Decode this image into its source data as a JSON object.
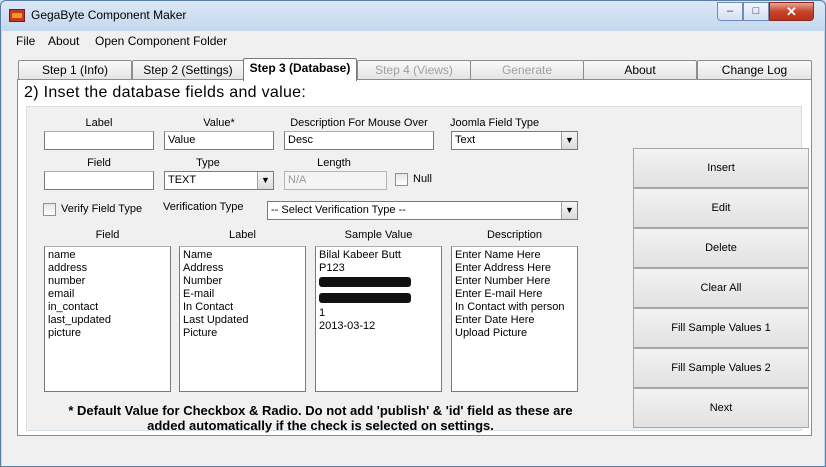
{
  "window": {
    "title": "GegaByte Component Maker",
    "min_glyph": "–",
    "max_glyph": "□",
    "close_glyph": "✕"
  },
  "menu": [
    "File",
    "About",
    "Open Component Folder"
  ],
  "tabs": [
    {
      "label": "Step 1 (Info)",
      "state": "normal"
    },
    {
      "label": "Step 2 (Settings)",
      "state": "normal"
    },
    {
      "label": "Step 3 (Database)",
      "state": "active"
    },
    {
      "label": "Step 4 (Views)",
      "state": "disabled"
    },
    {
      "label": "Generate",
      "state": "disabled"
    },
    {
      "label": "About",
      "state": "normal"
    },
    {
      "label": "Change Log",
      "state": "normal"
    }
  ],
  "heading": "2) Inset the database fields and value:",
  "form": {
    "label_lbl": "Label",
    "label_value": "",
    "value_lbl": "Value*",
    "value_value": "Value",
    "desc_lbl": "Description For Mouse Over",
    "desc_value": "Desc",
    "joomla_lbl": "Joomla Field Type",
    "joomla_value": "Text",
    "field_lbl": "Field",
    "field_value": "",
    "type_lbl": "Type",
    "type_value": "TEXT",
    "length_lbl": "Length",
    "length_value": "N/A",
    "null_lbl": "Null",
    "verify_lbl": "Verify Field Type",
    "vtype_lbl": "Verification Type",
    "vtype_value": "-- Select Verification Type --"
  },
  "lists": {
    "field_header": "Field",
    "label_header": "Label",
    "sample_header": "Sample Value",
    "desc_header": "Description",
    "fields": [
      "name",
      "address",
      "number",
      "email",
      "in_contact",
      "last_updated",
      "picture"
    ],
    "labels": [
      "Name",
      "Address",
      "Number",
      "E-mail",
      "In Contact",
      "Last Updated",
      "Picture"
    ],
    "samples": [
      "Bilal Kabeer Butt",
      "P123",
      "",
      "",
      "1",
      "2013-03-12"
    ],
    "descriptions": [
      "Enter Name Here",
      "Enter Address Here",
      "Enter Number Here",
      "Enter E-mail Here",
      "In Contact with person",
      "Enter Date Here",
      "Upload Picture"
    ]
  },
  "note_line1": "* Default Value for Checkbox & Radio. Do not add 'publish' & 'id' field as these are",
  "note_line2": "added automatically if the check is selected on settings.",
  "buttons": [
    "Insert",
    "Edit",
    "Delete",
    "Clear All",
    "Fill Sample Values 1",
    "Fill Sample Values 2",
    "Next"
  ]
}
